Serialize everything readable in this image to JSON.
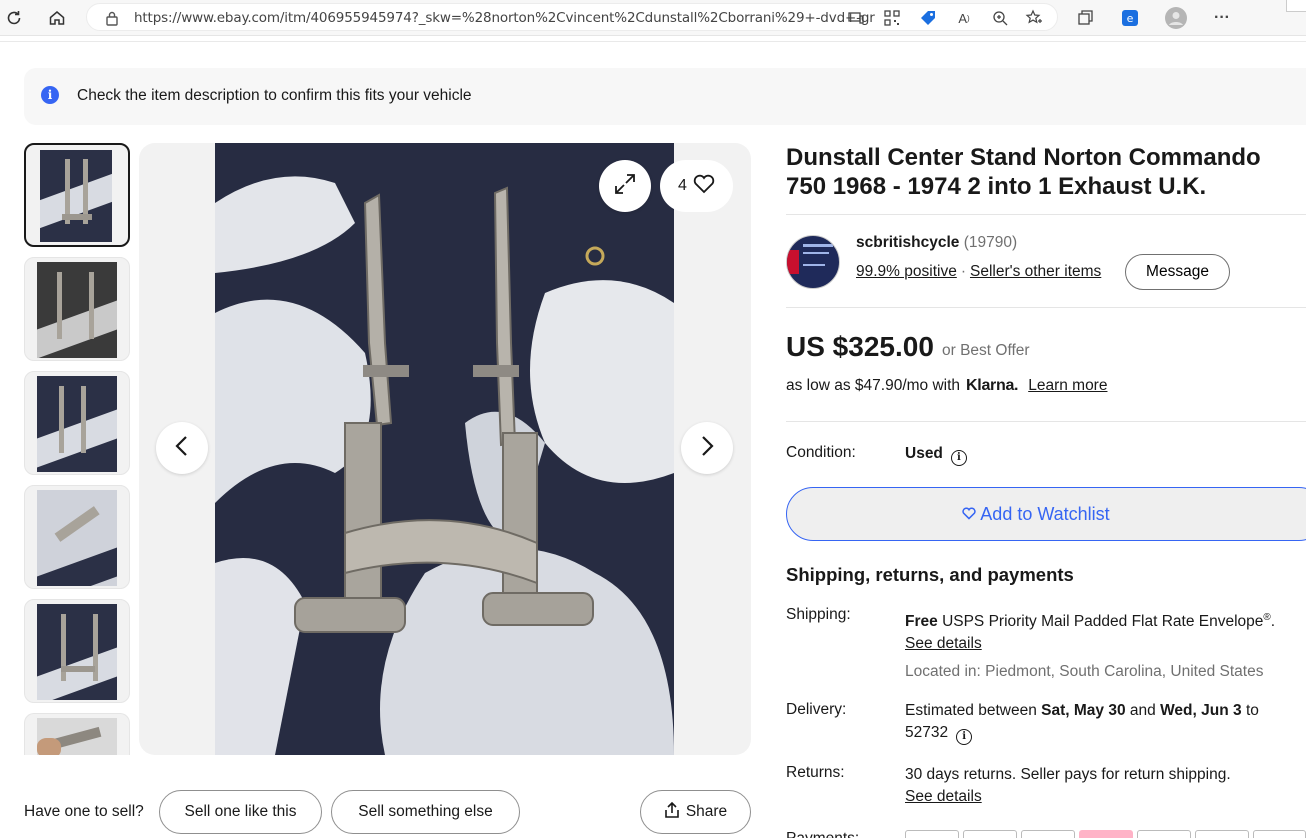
{
  "browser": {
    "url": "https://www.ebay.com/itm/406955945974?_skw=%28norton%2Cvincent%2Cdunstall%2Cborrani%29+-dvd+-gri..."
  },
  "alert": {
    "text": "Check the item description to confirm this fits your vehicle"
  },
  "gallery": {
    "like_count": "4"
  },
  "item": {
    "title": "Dunstall Center Stand Norton Commando 750 1968 - 1974 2 into 1 Exhaust U.K.",
    "price": "US $325.00",
    "best_offer": "or Best Offer",
    "klarna_prefix": "as low as $47.90/mo with",
    "klarna_brand": "Klarna.",
    "klarna_link": "Learn more",
    "condition_label": "Condition:",
    "condition_value": "Used",
    "watchlist_label": "Add to Watchlist"
  },
  "seller": {
    "name": "scbritishcycle",
    "feedback_count": "(19790)",
    "positive": "99.9% positive",
    "other_items": "Seller's other items",
    "message_label": "Message"
  },
  "shipping": {
    "heading": "Shipping, returns, and payments",
    "shipping_label": "Shipping:",
    "shipping_free": "Free",
    "shipping_service": "USPS Priority Mail Padded Flat Rate Envelope",
    "see_details": "See details",
    "located_prefix": "Located in:",
    "located": "Piedmont, South Carolina, United States",
    "delivery_label": "Delivery:",
    "delivery_prefix": "Estimated between",
    "delivery_start": "Sat, May 30",
    "delivery_and": "and",
    "delivery_end": "Wed, Jun 3",
    "delivery_to": "to",
    "delivery_zip": "52732",
    "returns_label": "Returns:",
    "returns_text": "30 days returns. Seller pays for return shipping.",
    "returns_details": "See details",
    "payments_label": "Payments:"
  },
  "actions": {
    "have_one": "Have one to sell?",
    "sell_like": "Sell one like this",
    "sell_else": "Sell something else",
    "share": "Share"
  },
  "colors": {
    "accent": "#3665f3",
    "text": "#191919",
    "muted": "#707070"
  }
}
